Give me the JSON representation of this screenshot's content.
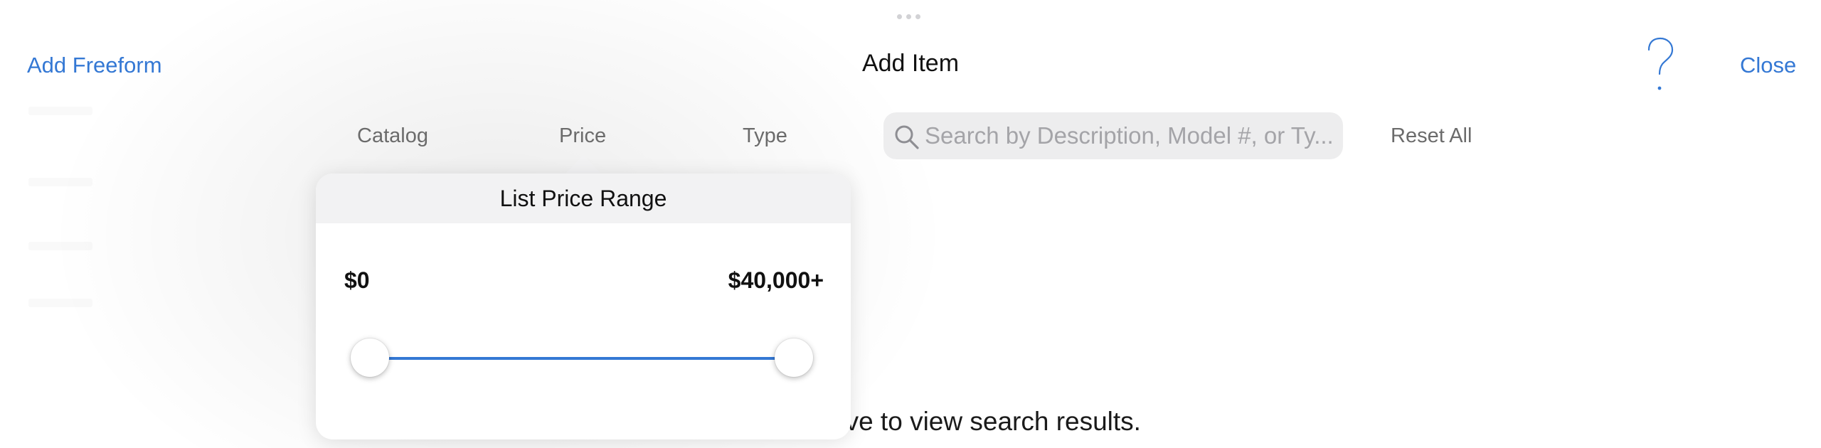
{
  "header": {
    "add_freeform": "Add Freeform",
    "title": "Add Item",
    "close": "Close",
    "help_icon": "question-mark-icon"
  },
  "filters": {
    "tabs": [
      {
        "label": "Catalog"
      },
      {
        "label": "Price",
        "selected": true
      },
      {
        "label": "Type"
      }
    ],
    "search": {
      "placeholder": "Search by Description, Model #, or Ty...",
      "value": "",
      "icon": "search-icon"
    },
    "reset": "Reset All"
  },
  "price_popover": {
    "title": "List Price Range",
    "min_label": "$0",
    "max_label": "$40,000+",
    "slider": {
      "min_fraction": 0.0,
      "max_fraction": 1.0
    }
  },
  "main": {
    "hint_partial": "ove to view search results."
  },
  "colors": {
    "accent": "#3478d4",
    "popover_header": "#f2f2f3",
    "search_bg": "#ededee",
    "secondary_text": "#6b6b6b"
  }
}
